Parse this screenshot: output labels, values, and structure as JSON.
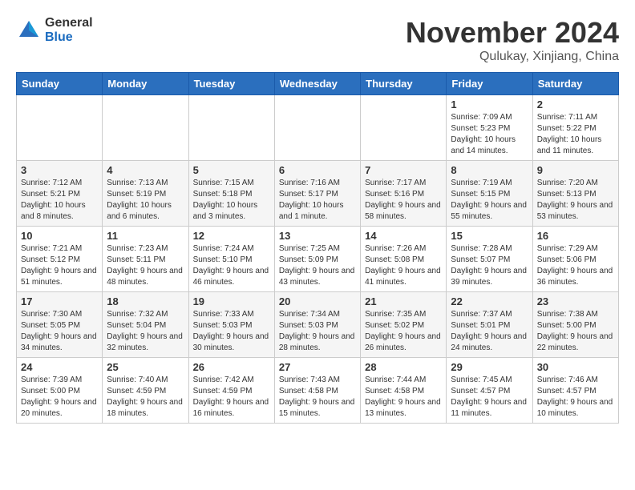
{
  "logo": {
    "general": "General",
    "blue": "Blue"
  },
  "title": "November 2024",
  "location": "Qulukay, Xinjiang, China",
  "headers": [
    "Sunday",
    "Monday",
    "Tuesday",
    "Wednesday",
    "Thursday",
    "Friday",
    "Saturday"
  ],
  "weeks": [
    [
      {
        "day": "",
        "info": ""
      },
      {
        "day": "",
        "info": ""
      },
      {
        "day": "",
        "info": ""
      },
      {
        "day": "",
        "info": ""
      },
      {
        "day": "",
        "info": ""
      },
      {
        "day": "1",
        "info": "Sunrise: 7:09 AM\nSunset: 5:23 PM\nDaylight: 10 hours and 14 minutes."
      },
      {
        "day": "2",
        "info": "Sunrise: 7:11 AM\nSunset: 5:22 PM\nDaylight: 10 hours and 11 minutes."
      }
    ],
    [
      {
        "day": "3",
        "info": "Sunrise: 7:12 AM\nSunset: 5:21 PM\nDaylight: 10 hours and 8 minutes."
      },
      {
        "day": "4",
        "info": "Sunrise: 7:13 AM\nSunset: 5:19 PM\nDaylight: 10 hours and 6 minutes."
      },
      {
        "day": "5",
        "info": "Sunrise: 7:15 AM\nSunset: 5:18 PM\nDaylight: 10 hours and 3 minutes."
      },
      {
        "day": "6",
        "info": "Sunrise: 7:16 AM\nSunset: 5:17 PM\nDaylight: 10 hours and 1 minute."
      },
      {
        "day": "7",
        "info": "Sunrise: 7:17 AM\nSunset: 5:16 PM\nDaylight: 9 hours and 58 minutes."
      },
      {
        "day": "8",
        "info": "Sunrise: 7:19 AM\nSunset: 5:15 PM\nDaylight: 9 hours and 55 minutes."
      },
      {
        "day": "9",
        "info": "Sunrise: 7:20 AM\nSunset: 5:13 PM\nDaylight: 9 hours and 53 minutes."
      }
    ],
    [
      {
        "day": "10",
        "info": "Sunrise: 7:21 AM\nSunset: 5:12 PM\nDaylight: 9 hours and 51 minutes."
      },
      {
        "day": "11",
        "info": "Sunrise: 7:23 AM\nSunset: 5:11 PM\nDaylight: 9 hours and 48 minutes."
      },
      {
        "day": "12",
        "info": "Sunrise: 7:24 AM\nSunset: 5:10 PM\nDaylight: 9 hours and 46 minutes."
      },
      {
        "day": "13",
        "info": "Sunrise: 7:25 AM\nSunset: 5:09 PM\nDaylight: 9 hours and 43 minutes."
      },
      {
        "day": "14",
        "info": "Sunrise: 7:26 AM\nSunset: 5:08 PM\nDaylight: 9 hours and 41 minutes."
      },
      {
        "day": "15",
        "info": "Sunrise: 7:28 AM\nSunset: 5:07 PM\nDaylight: 9 hours and 39 minutes."
      },
      {
        "day": "16",
        "info": "Sunrise: 7:29 AM\nSunset: 5:06 PM\nDaylight: 9 hours and 36 minutes."
      }
    ],
    [
      {
        "day": "17",
        "info": "Sunrise: 7:30 AM\nSunset: 5:05 PM\nDaylight: 9 hours and 34 minutes."
      },
      {
        "day": "18",
        "info": "Sunrise: 7:32 AM\nSunset: 5:04 PM\nDaylight: 9 hours and 32 minutes."
      },
      {
        "day": "19",
        "info": "Sunrise: 7:33 AM\nSunset: 5:03 PM\nDaylight: 9 hours and 30 minutes."
      },
      {
        "day": "20",
        "info": "Sunrise: 7:34 AM\nSunset: 5:03 PM\nDaylight: 9 hours and 28 minutes."
      },
      {
        "day": "21",
        "info": "Sunrise: 7:35 AM\nSunset: 5:02 PM\nDaylight: 9 hours and 26 minutes."
      },
      {
        "day": "22",
        "info": "Sunrise: 7:37 AM\nSunset: 5:01 PM\nDaylight: 9 hours and 24 minutes."
      },
      {
        "day": "23",
        "info": "Sunrise: 7:38 AM\nSunset: 5:00 PM\nDaylight: 9 hours and 22 minutes."
      }
    ],
    [
      {
        "day": "24",
        "info": "Sunrise: 7:39 AM\nSunset: 5:00 PM\nDaylight: 9 hours and 20 minutes."
      },
      {
        "day": "25",
        "info": "Sunrise: 7:40 AM\nSunset: 4:59 PM\nDaylight: 9 hours and 18 minutes."
      },
      {
        "day": "26",
        "info": "Sunrise: 7:42 AM\nSunset: 4:59 PM\nDaylight: 9 hours and 16 minutes."
      },
      {
        "day": "27",
        "info": "Sunrise: 7:43 AM\nSunset: 4:58 PM\nDaylight: 9 hours and 15 minutes."
      },
      {
        "day": "28",
        "info": "Sunrise: 7:44 AM\nSunset: 4:58 PM\nDaylight: 9 hours and 13 minutes."
      },
      {
        "day": "29",
        "info": "Sunrise: 7:45 AM\nSunset: 4:57 PM\nDaylight: 9 hours and 11 minutes."
      },
      {
        "day": "30",
        "info": "Sunrise: 7:46 AM\nSunset: 4:57 PM\nDaylight: 9 hours and 10 minutes."
      }
    ]
  ]
}
